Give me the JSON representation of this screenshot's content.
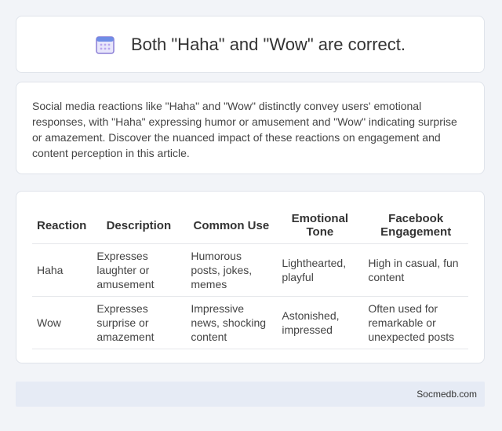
{
  "header": {
    "icon": "calendar-icon",
    "title": "Both \"Haha\" and \"Wow\" are correct."
  },
  "intro": {
    "text": "Social media reactions like \"Haha\" and \"Wow\" distinctly convey users' emotional responses, with \"Haha\" expressing humor or amusement and \"Wow\" indicating surprise or amazement. Discover the nuanced impact of these reactions on engagement and content perception in this article."
  },
  "table": {
    "headers": [
      "Reaction",
      "Description",
      "Common Use",
      "Emotional Tone",
      "Facebook Engagement"
    ],
    "rows": [
      [
        "Haha",
        "Expresses laughter or amusement",
        "Humorous posts, jokes, memes",
        "Lighthearted, playful",
        "High in casual, fun content"
      ],
      [
        "Wow",
        "Expresses surprise or amazement",
        "Impressive news, shocking content",
        "Astonished, impressed",
        "Often used for remarkable or unexpected posts"
      ]
    ]
  },
  "footer": {
    "site": "Socmedb.com"
  },
  "colors": {
    "background": "#f2f4f8",
    "footer_bg": "#e6ebf5",
    "icon_purple": "#8b7fd6"
  }
}
